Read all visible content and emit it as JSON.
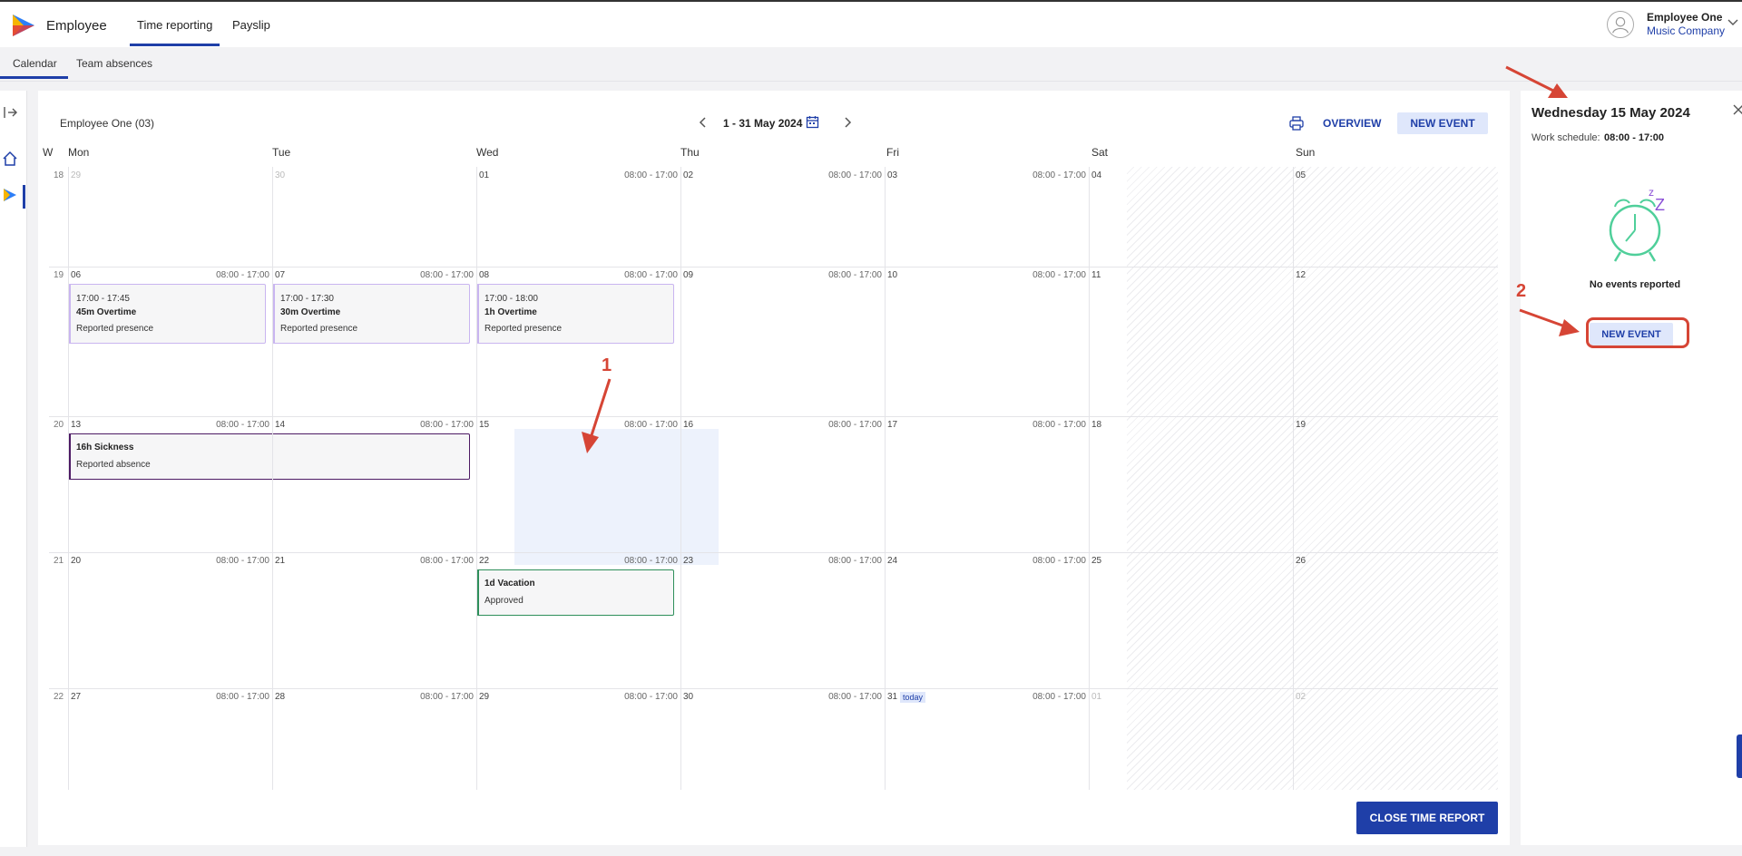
{
  "app": {
    "name": "Employee",
    "nav_tabs": [
      "Time reporting",
      "Payslip"
    ],
    "user": {
      "name": "Employee One",
      "company": "Music Company"
    }
  },
  "subnav": {
    "tabs": [
      "Calendar",
      "Team absences"
    ]
  },
  "toolbar": {
    "employee": "Employee One (03)",
    "period": "1 - 31 May 2024",
    "overview_label": "OVERVIEW",
    "new_event_label": "NEW EVENT"
  },
  "calendar": {
    "week_header": "W",
    "days": [
      "Mon",
      "Tue",
      "Wed",
      "Thu",
      "Fri",
      "Sat",
      "Sun"
    ],
    "weeks": [
      {
        "week": "18",
        "dates": [
          "29",
          "30",
          "01",
          "02",
          "03",
          "04",
          "05"
        ],
        "schedules": [
          "",
          "",
          "08:00 - 17:00",
          "08:00 - 17:00",
          "08:00 - 17:00",
          "",
          ""
        ]
      },
      {
        "week": "19",
        "dates": [
          "06",
          "07",
          "08",
          "09",
          "10",
          "11",
          "12"
        ],
        "schedules": [
          "08:00 - 17:00",
          "08:00 - 17:00",
          "08:00 - 17:00",
          "08:00 - 17:00",
          "08:00 - 17:00",
          "",
          ""
        ]
      },
      {
        "week": "20",
        "dates": [
          "13",
          "14",
          "15",
          "16",
          "17",
          "18",
          "19"
        ],
        "schedules": [
          "08:00 - 17:00",
          "08:00 - 17:00",
          "08:00 - 17:00",
          "08:00 - 17:00",
          "08:00 - 17:00",
          "",
          ""
        ]
      },
      {
        "week": "21",
        "dates": [
          "20",
          "21",
          "22",
          "23",
          "24",
          "25",
          "26"
        ],
        "schedules": [
          "08:00 - 17:00",
          "08:00 - 17:00",
          "08:00 - 17:00",
          "08:00 - 17:00",
          "08:00 - 17:00",
          "",
          ""
        ]
      },
      {
        "week": "22",
        "dates": [
          "27",
          "28",
          "29",
          "30",
          "31",
          "01",
          "02"
        ],
        "schedules": [
          "08:00 - 17:00",
          "08:00 - 17:00",
          "08:00 - 17:00",
          "08:00 - 17:00",
          "08:00 - 17:00",
          "",
          ""
        ]
      }
    ],
    "today_label": "today",
    "events": {
      "ot1": {
        "time": "17:00 - 17:45",
        "title": "45m Overtime",
        "status": "Reported presence"
      },
      "ot2": {
        "time": "17:00 - 17:30",
        "title": "30m Overtime",
        "status": "Reported presence"
      },
      "ot3": {
        "time": "17:00 - 18:00",
        "title": "1h Overtime",
        "status": "Reported presence"
      },
      "sick": {
        "title": "16h Sickness",
        "status": "Reported absence"
      },
      "vac": {
        "title": "1d Vacation",
        "status": "Approved"
      }
    },
    "close_label": "CLOSE TIME REPORT"
  },
  "side_panel": {
    "title": "Wednesday 15 May 2024",
    "schedule_label": "Work schedule:",
    "schedule_value": "08:00 - 17:00",
    "empty_text": "No events reported",
    "new_event_label": "NEW EVENT"
  },
  "annotations": {
    "one": "1",
    "two": "2"
  },
  "colors": {
    "primary": "#1f3fa8",
    "primary_light": "#dfe7fb",
    "overtime": "#c9b5f0",
    "sickness": "#4d1a64",
    "vacation": "#2e8f5a",
    "annotation": "#d64535"
  },
  "icons": [
    "play-logo-icon",
    "user-avatar-icon",
    "chevron-down-icon",
    "collapse-sidebar-icon",
    "home-icon",
    "chevron-left-icon",
    "calendar-icon",
    "chevron-right-icon",
    "print-icon",
    "close-icon",
    "sleeping-alarm-clock-icon"
  ]
}
